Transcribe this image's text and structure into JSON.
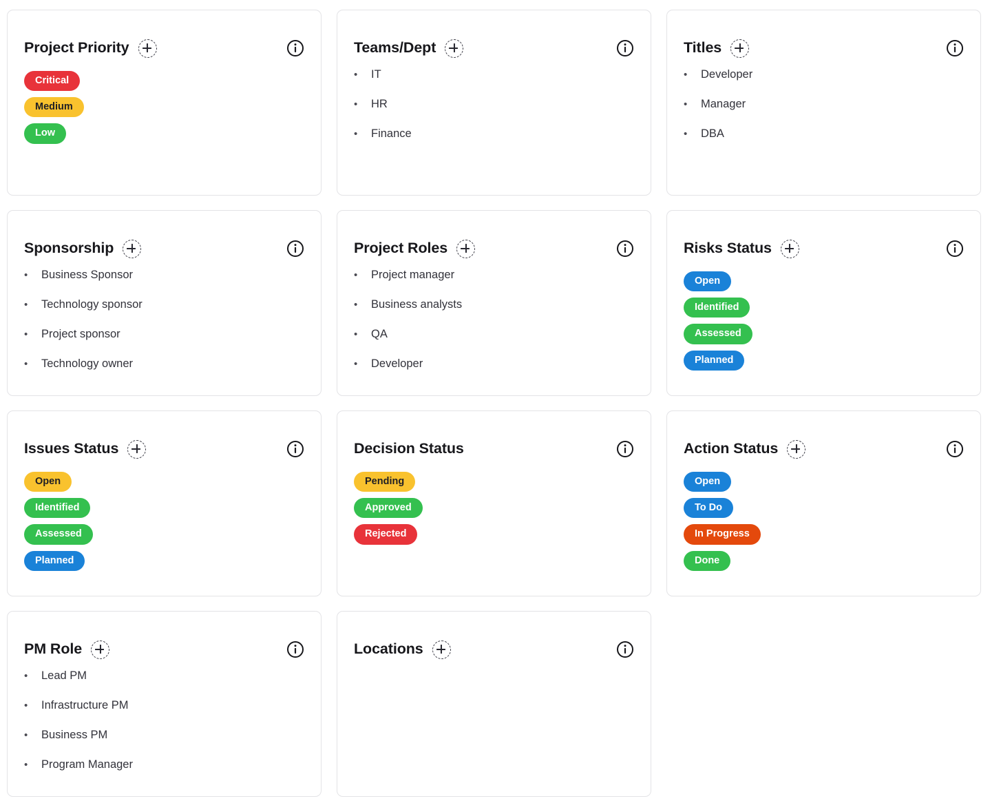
{
  "icons": {
    "add": "plus-circle-dashed-icon",
    "info": "info-circle-icon"
  },
  "palette": {
    "red": "#e8333a",
    "amber": "#f9c22e",
    "green": "#34c04f",
    "blue": "#1a82d8",
    "orange": "#e4490c",
    "amber_text": "#1f1f25",
    "white_text": "#ffffff"
  },
  "cards": [
    {
      "title": "Project Priority",
      "has_add": true,
      "has_info": true,
      "type": "pills",
      "items": [
        {
          "label": "Critical",
          "bg": "#e8333a",
          "fg": "#ffffff"
        },
        {
          "label": "Medium",
          "bg": "#f9c22e",
          "fg": "#1f1f25"
        },
        {
          "label": "Low",
          "bg": "#34c04f",
          "fg": "#ffffff"
        }
      ]
    },
    {
      "title": "Teams/Dept",
      "has_add": true,
      "has_info": true,
      "type": "bullets",
      "items": [
        {
          "label": "IT"
        },
        {
          "label": "HR"
        },
        {
          "label": "Finance"
        }
      ]
    },
    {
      "title": "Titles",
      "has_add": true,
      "has_info": true,
      "type": "bullets",
      "items": [
        {
          "label": "Developer"
        },
        {
          "label": "Manager"
        },
        {
          "label": "DBA"
        }
      ]
    },
    {
      "title": "Sponsorship",
      "has_add": true,
      "has_info": true,
      "type": "bullets",
      "items": [
        {
          "label": "Business Sponsor"
        },
        {
          "label": "Technology sponsor"
        },
        {
          "label": "Project sponsor"
        },
        {
          "label": "Technology owner"
        }
      ]
    },
    {
      "title": "Project Roles",
      "has_add": true,
      "has_info": true,
      "type": "bullets",
      "items": [
        {
          "label": "Project manager"
        },
        {
          "label": "Business analysts"
        },
        {
          "label": "QA"
        },
        {
          "label": "Developer"
        }
      ]
    },
    {
      "title": "Risks Status",
      "has_add": true,
      "has_info": true,
      "type": "pills",
      "items": [
        {
          "label": "Open",
          "bg": "#1a82d8",
          "fg": "#ffffff"
        },
        {
          "label": "Identified",
          "bg": "#34c04f",
          "fg": "#ffffff"
        },
        {
          "label": "Assessed",
          "bg": "#34c04f",
          "fg": "#ffffff"
        },
        {
          "label": "Planned",
          "bg": "#1a82d8",
          "fg": "#ffffff"
        }
      ]
    },
    {
      "title": "Issues Status",
      "has_add": true,
      "has_info": true,
      "type": "pills",
      "items": [
        {
          "label": "Open",
          "bg": "#f9c22e",
          "fg": "#1f1f25"
        },
        {
          "label": "Identified",
          "bg": "#34c04f",
          "fg": "#ffffff"
        },
        {
          "label": "Assessed",
          "bg": "#34c04f",
          "fg": "#ffffff"
        },
        {
          "label": "Planned",
          "bg": "#1a82d8",
          "fg": "#ffffff"
        }
      ]
    },
    {
      "title": "Decision Status",
      "has_add": false,
      "has_info": true,
      "type": "pills",
      "items": [
        {
          "label": "Pending",
          "bg": "#f9c22e",
          "fg": "#1f1f25"
        },
        {
          "label": "Approved",
          "bg": "#34c04f",
          "fg": "#ffffff"
        },
        {
          "label": "Rejected",
          "bg": "#e8333a",
          "fg": "#ffffff"
        }
      ]
    },
    {
      "title": "Action Status",
      "has_add": true,
      "has_info": true,
      "type": "pills",
      "items": [
        {
          "label": "Open",
          "bg": "#1a82d8",
          "fg": "#ffffff"
        },
        {
          "label": "To Do",
          "bg": "#1a82d8",
          "fg": "#ffffff"
        },
        {
          "label": "In Progress",
          "bg": "#e4490c",
          "fg": "#ffffff"
        },
        {
          "label": "Done",
          "bg": "#34c04f",
          "fg": "#ffffff"
        }
      ]
    },
    {
      "title": "PM Role",
      "has_add": true,
      "has_info": true,
      "type": "bullets",
      "items": [
        {
          "label": "Lead PM"
        },
        {
          "label": "Infrastructure PM"
        },
        {
          "label": "Business PM"
        },
        {
          "label": "Program Manager"
        }
      ]
    },
    {
      "title": "Locations",
      "has_add": true,
      "has_info": true,
      "type": "bullets",
      "items": []
    }
  ]
}
